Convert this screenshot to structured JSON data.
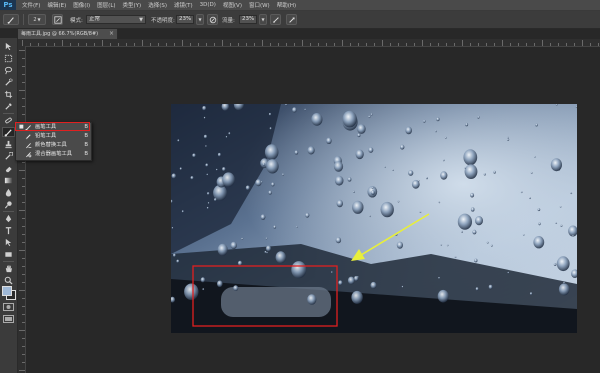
{
  "app": {
    "logo": "Ps"
  },
  "menubar": {
    "items": [
      "文件(F)",
      "编辑(E)",
      "图像(I)",
      "图层(L)",
      "类型(Y)",
      "选择(S)",
      "滤镜(T)",
      "3D(D)",
      "视图(V)",
      "窗口(W)",
      "帮助(H)"
    ]
  },
  "options": {
    "brush_size": "2",
    "mode_label": "模式:",
    "mode_value": "正常",
    "opacity_label": "不透明度:",
    "opacity_value": "23%",
    "flow_label": "流量:",
    "flow_value": "23%"
  },
  "document": {
    "tab_title": "每雨工具.jpg @ 66.7%(RGB/8#)",
    "close": "×"
  },
  "tool_flyout": {
    "items": [
      {
        "label": "画笔工具",
        "shortcut": "B",
        "selected": true,
        "bullet": "■"
      },
      {
        "label": "铅笔工具",
        "shortcut": "B",
        "selected": false,
        "bullet": ""
      },
      {
        "label": "颜色替换工具",
        "shortcut": "B",
        "selected": false,
        "bullet": ""
      },
      {
        "label": "混合器画笔工具",
        "shortcut": "B",
        "selected": false,
        "bullet": ""
      }
    ]
  },
  "colors": {
    "foreground": "#9fb8d6",
    "background": "#2b2b2b",
    "highlight": "#e02020",
    "arrow": "#e8ef3a"
  }
}
